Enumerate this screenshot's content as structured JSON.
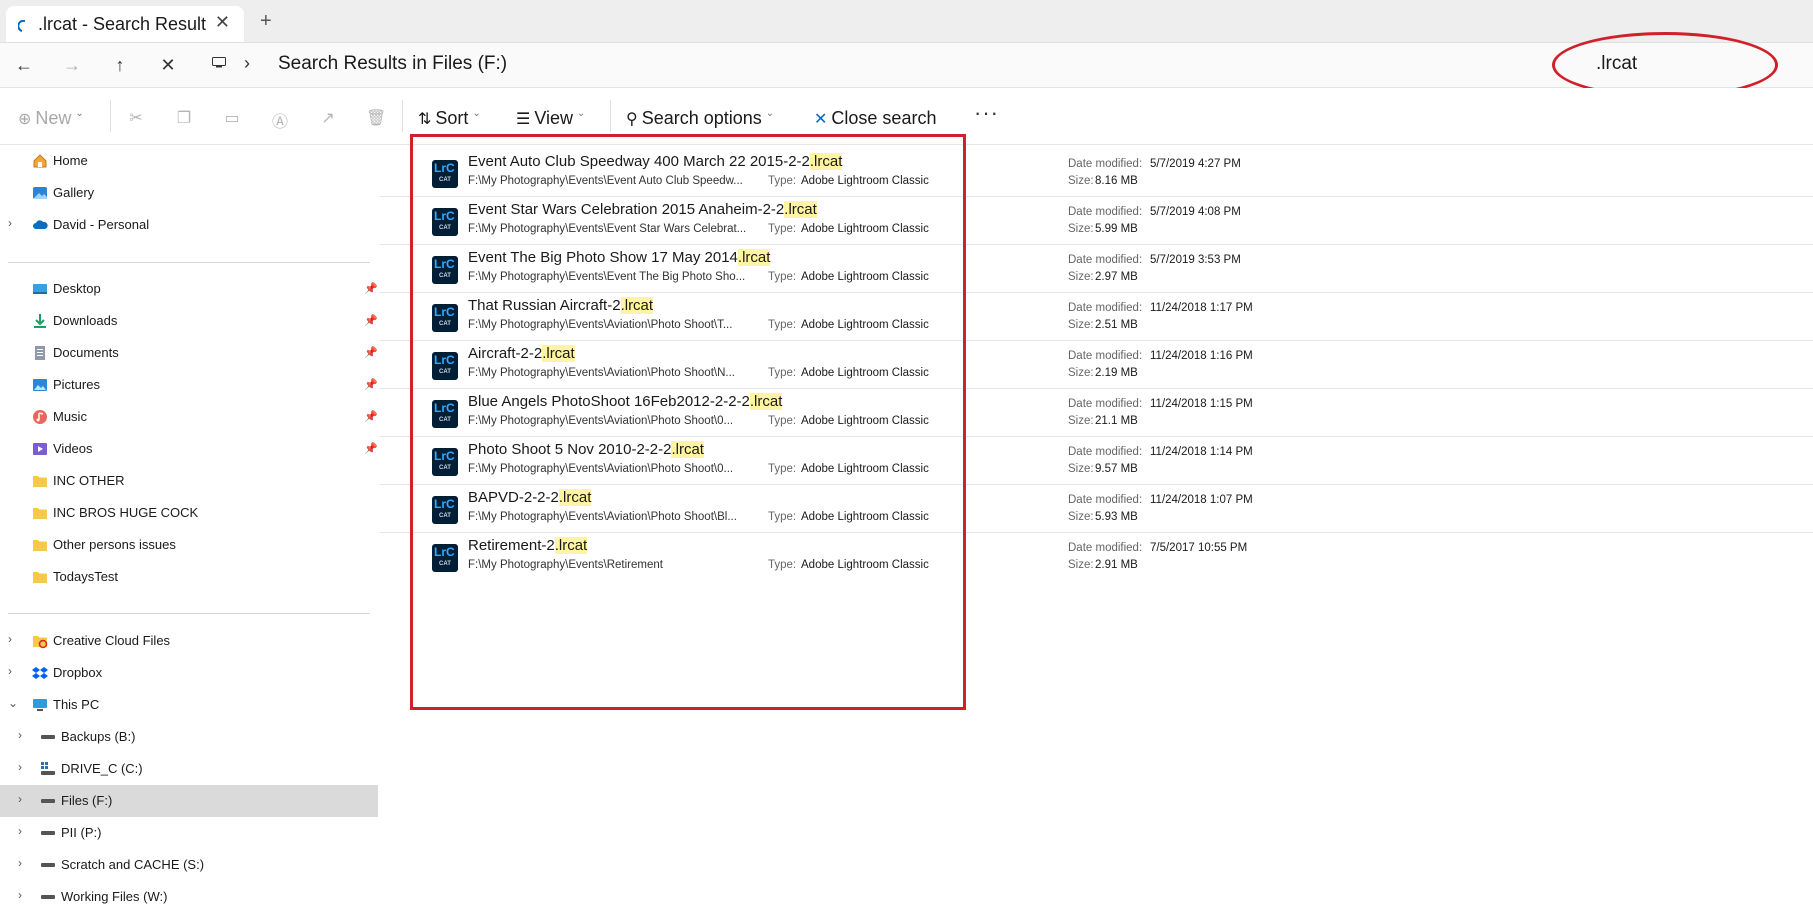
{
  "tab": {
    "title": ".lrcat - Search Result",
    "close": "✕",
    "new_tab": "+"
  },
  "nav": {
    "back": "←",
    "forward": "→",
    "up": "↑",
    "stop": "✕"
  },
  "address": {
    "separator": "›",
    "location": "Search Results in Files (F:)"
  },
  "search": {
    "value": ".lrcat"
  },
  "toolbar": {
    "new_label": "New",
    "sort_label": "Sort",
    "view_label": "View",
    "search_options_label": "Search options",
    "close_search_label": "Close search",
    "more_label": "···"
  },
  "sidebar": {
    "items": [
      {
        "label": "Home",
        "icon": "home-icon"
      },
      {
        "label": "Gallery",
        "icon": "gallery-icon"
      },
      {
        "label": "David - Personal",
        "icon": "cloud-icon"
      },
      {
        "label": "Desktop",
        "icon": "desktop-icon"
      },
      {
        "label": "Downloads",
        "icon": "downloads-icon"
      },
      {
        "label": "Documents",
        "icon": "documents-icon"
      },
      {
        "label": "Pictures",
        "icon": "pictures-icon"
      },
      {
        "label": "Music",
        "icon": "music-icon"
      },
      {
        "label": "Videos",
        "icon": "videos-icon"
      },
      {
        "label": "INC OTHER",
        "icon": "folder-icon"
      },
      {
        "label": "INC BROS HUGE COCK",
        "icon": "folder-icon"
      },
      {
        "label": "Other persons issues",
        "icon": "folder-icon"
      },
      {
        "label": "TodaysTest",
        "icon": "folder-icon"
      },
      {
        "label": "Creative Cloud Files",
        "icon": "creative-cloud-icon"
      },
      {
        "label": "Dropbox",
        "icon": "dropbox-icon"
      },
      {
        "label": "This PC",
        "icon": "pc-icon"
      },
      {
        "label": "Backups (B:)",
        "icon": "drive-icon"
      },
      {
        "label": "DRIVE_C (C:)",
        "icon": "system-drive-icon"
      },
      {
        "label": "Files (F:)",
        "icon": "drive-icon"
      },
      {
        "label": "PII (P:)",
        "icon": "drive-icon"
      },
      {
        "label": "Scratch and CACHE (S:)",
        "icon": "drive-icon"
      },
      {
        "label": "Working Files (W:)",
        "icon": "drive-icon"
      }
    ]
  },
  "results": {
    "icon_label_big": "LrC",
    "icon_label_small": "CAT",
    "highlight": ".lrcat",
    "type_label": "Type:",
    "date_label": "Date modified:",
    "size_label": "Size:",
    "items": [
      {
        "name": "Event Auto Club Speedway 400 March 22 2015-2-2",
        "path": "F:\\My Photography\\Events\\Event Auto Club Speedw...",
        "type": "Adobe Lightroom Classic",
        "date": "5/7/2019 4:27 PM",
        "size": "8.16 MB"
      },
      {
        "name": "Event Star Wars Celebration 2015 Anaheim-2-2",
        "path": "F:\\My Photography\\Events\\Event Star Wars Celebrat...",
        "type": "Adobe Lightroom Classic",
        "date": "5/7/2019 4:08 PM",
        "size": "5.99 MB"
      },
      {
        "name": "Event The Big Photo Show 17 May 2014",
        "path": "F:\\My Photography\\Events\\Event The Big Photo Sho...",
        "type": "Adobe Lightroom Classic",
        "date": "5/7/2019 3:53 PM",
        "size": "2.97 MB"
      },
      {
        "name": "That Russian Aircraft-2",
        "path": "F:\\My Photography\\Events\\Aviation\\Photo Shoot\\T...",
        "type": "Adobe Lightroom Classic",
        "date": "11/24/2018 1:17 PM",
        "size": "2.51 MB"
      },
      {
        "name": "Aircraft-2-2",
        "path": "F:\\My Photography\\Events\\Aviation\\Photo Shoot\\N...",
        "type": "Adobe Lightroom Classic",
        "date": "11/24/2018 1:16 PM",
        "size": "2.19 MB"
      },
      {
        "name": "Blue Angels PhotoShoot 16Feb2012-2-2-2",
        "path": "F:\\My Photography\\Events\\Aviation\\Photo Shoot\\0...",
        "type": "Adobe Lightroom Classic",
        "date": "11/24/2018 1:15 PM",
        "size": "21.1 MB"
      },
      {
        "name": "Photo Shoot 5 Nov 2010-2-2-2",
        "path": "F:\\My Photography\\Events\\Aviation\\Photo Shoot\\0...",
        "type": "Adobe Lightroom Classic",
        "date": "11/24/2018 1:14 PM",
        "size": "9.57 MB"
      },
      {
        "name": "BAPVD-2-2-2",
        "path": "F:\\My Photography\\Events\\Aviation\\Photo Shoot\\Bl...",
        "type": "Adobe Lightroom Classic",
        "date": "11/24/2018 1:07 PM",
        "size": "5.93 MB"
      },
      {
        "name": "Retirement-2",
        "path": "F:\\My Photography\\Events\\Retirement",
        "type": "Adobe Lightroom Classic",
        "date": "7/5/2017 10:55 PM",
        "size": "2.91 MB"
      }
    ]
  },
  "colors": {
    "accent": "#0067c0",
    "highlight": "#fff59e",
    "annotation": "#d0202a",
    "lrc_bg": "#001e36",
    "lrc_fg": "#31a8ff"
  }
}
